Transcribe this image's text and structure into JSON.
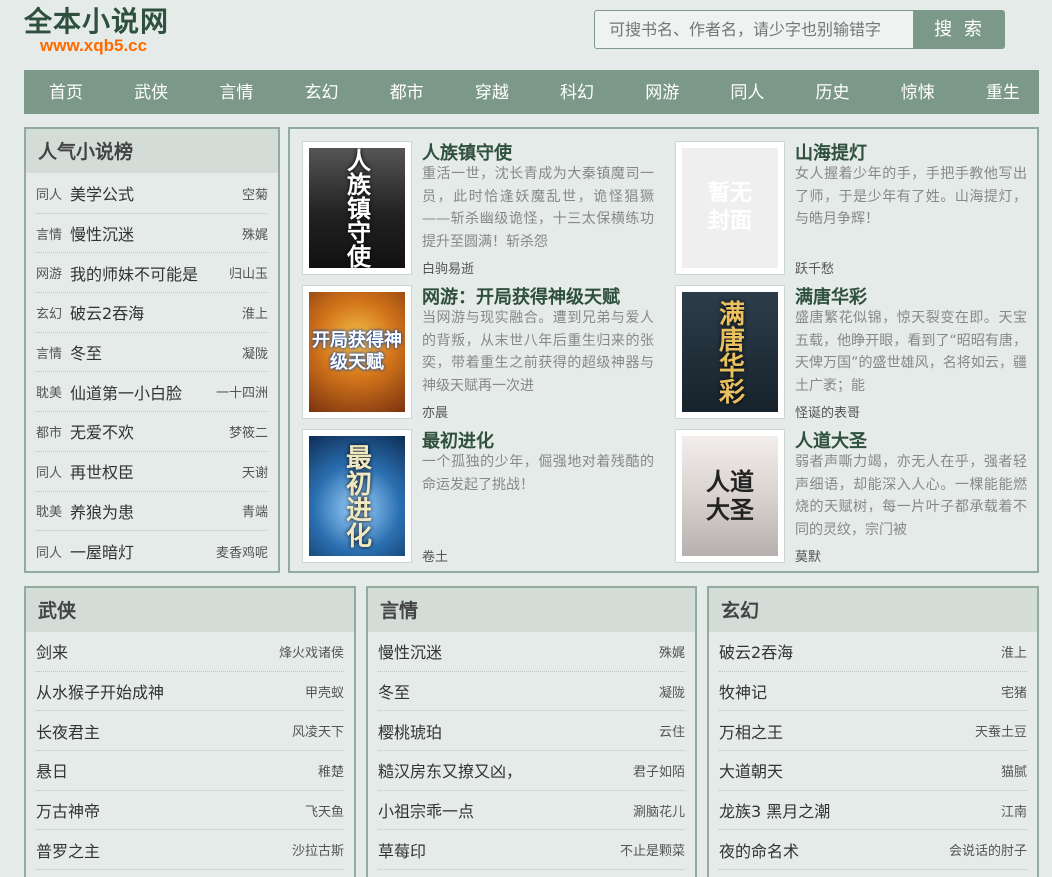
{
  "site": {
    "title": "全本小说网",
    "url": "www.xqb5.cc"
  },
  "search": {
    "placeholder": "可搜书名、作者名，请少字也别输错字",
    "button": "搜 索"
  },
  "nav": [
    "首页",
    "武侠",
    "言情",
    "玄幻",
    "都市",
    "穿越",
    "科幻",
    "网游",
    "同人",
    "历史",
    "惊悚",
    "重生"
  ],
  "popular": {
    "title": "人气小说榜",
    "items": [
      {
        "cat": "同人",
        "title": "美学公式",
        "author": "空菊"
      },
      {
        "cat": "言情",
        "title": "慢性沉迷",
        "author": "殊娓"
      },
      {
        "cat": "网游",
        "title": "我的师妹不可能是",
        "author": "归山玉"
      },
      {
        "cat": "玄幻",
        "title": "破云2吞海",
        "author": "淮上"
      },
      {
        "cat": "言情",
        "title": "冬至",
        "author": "凝陇"
      },
      {
        "cat": "耽美",
        "title": "仙道第一小白脸",
        "author": "一十四洲"
      },
      {
        "cat": "都市",
        "title": "无爱不欢",
        "author": "梦筱二"
      },
      {
        "cat": "同人",
        "title": "再世权臣",
        "author": "天谢"
      },
      {
        "cat": "耽美",
        "title": "养狼为患",
        "author": "青端"
      },
      {
        "cat": "同人",
        "title": "一屋暗灯",
        "author": "麦香鸡呢"
      }
    ]
  },
  "featured": [
    {
      "title": "人族镇守使",
      "desc": "重活一世，沈长青成为大秦镇魔司一员，此时恰逢妖魔乱世，诡怪猖獗——斩杀幽级诡怪，十三太保横练功提升至圆满！斩杀怨",
      "author": "白驹易逝",
      "cover_text": "人族镇守使",
      "cover_color": "#2a2a2a"
    },
    {
      "title": "山海提灯",
      "desc": "女人握着少年的手，手把手教他写出了师，于是少年有了姓。山海提灯，与皓月争辉！",
      "author": "跃千愁",
      "cover_text": "暂无封面",
      "cover_color": "#eeeeee"
    },
    {
      "title": "网游：开局获得神级天赋",
      "desc": "当网游与现实融合。遭到兄弟与爱人的背叛，从末世八年后重生归来的张奕，带着重生之前获得的超级神器与神级天赋再一次进",
      "author": "亦晨",
      "cover_text": "开局获得神级天赋",
      "cover_color": "#c8761e"
    },
    {
      "title": "满唐华彩",
      "desc": "盛唐繁花似锦，惊天裂变在即。天宝五载，他睁开眼，看到了“昭昭有唐，天俾万国”的盛世雄风，名将如云，疆土广袤；能",
      "author": "怪诞的表哥",
      "cover_text": "满唐华彩",
      "cover_color": "#1c2a36"
    },
    {
      "title": "最初进化",
      "desc": "一个孤独的少年，倔强地对着残酷的命运发起了挑战！",
      "author": "卷土",
      "cover_text": "最初进化",
      "cover_color": "#2b6fb0"
    },
    {
      "title": "人道大圣",
      "desc": "弱者声嘶力竭，亦无人在乎，强者轻声细语，却能深入人心。一棵能能燃烧的天赋树，每一片叶子都承载着不同的灵纹，宗门被",
      "author": "莫默",
      "cover_text": "人道大圣",
      "cover_color": "#d9d2cf"
    }
  ],
  "wuxia": {
    "title": "武侠",
    "items": [
      {
        "title": "剑来",
        "author": "烽火戏诸侯"
      },
      {
        "title": "从水猴子开始成神",
        "author": "甲壳蚁"
      },
      {
        "title": "长夜君主",
        "author": "风凌天下"
      },
      {
        "title": "悬日",
        "author": "稚楚"
      },
      {
        "title": "万古神帝",
        "author": "飞天鱼"
      },
      {
        "title": "普罗之主",
        "author": "沙拉古斯"
      }
    ]
  },
  "yanqing": {
    "title": "言情",
    "items": [
      {
        "title": "慢性沉迷",
        "author": "殊娓"
      },
      {
        "title": "冬至",
        "author": "凝陇"
      },
      {
        "title": "樱桃琥珀",
        "author": "云住"
      },
      {
        "title": "糙汉房东又撩又凶，",
        "author": "君子如陌"
      },
      {
        "title": "小祖宗乖一点",
        "author": "涮脑花儿"
      },
      {
        "title": "草莓印",
        "author": "不止是颗菜"
      }
    ]
  },
  "xuanhuan": {
    "title": "玄幻",
    "items": [
      {
        "title": "破云2吞海",
        "author": "淮上"
      },
      {
        "title": "牧神记",
        "author": "宅猪"
      },
      {
        "title": "万相之王",
        "author": "天蚕土豆"
      },
      {
        "title": "大道朝天",
        "author": "猫腻"
      },
      {
        "title": "龙族3 黑月之潮",
        "author": "江南"
      },
      {
        "title": "夜的命名术",
        "author": "会说话的肘子"
      }
    ]
  }
}
